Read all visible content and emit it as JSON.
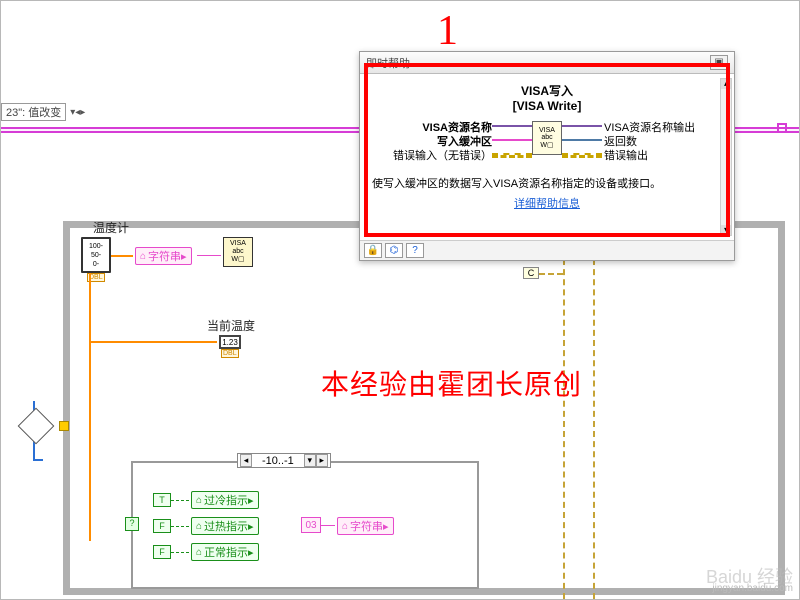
{
  "annotation": {
    "number": "1",
    "credit": "本经验由霍团长原创"
  },
  "topSelector": "23\": 值改变",
  "help": {
    "windowTitle": "即时帮助",
    "title1": "VISA写入",
    "title2": "[VISA Write]",
    "port_in_name": "VISA资源名称",
    "port_in_buf": "写入缓冲区",
    "port_in_err": "错误输入（无错误）",
    "port_out_name": "VISA资源名称输出",
    "port_out_ret": "返回数",
    "port_out_err": "错误输出",
    "desc": "使写入缓冲区的数据写入VISA资源名称指定的设备或接口。",
    "detailLink": "详细帮助信息",
    "iconTop": "VISA",
    "iconMid": "abc",
    "iconBot": "W▢"
  },
  "labels": {
    "thermometer": "温度计",
    "stringLink": "字符串",
    "currentTemp": "当前温度",
    "coldIndicator": "过冷指示",
    "hotIndicator": "过热指示",
    "normalIndicator": "正常指示"
  },
  "case": {
    "selector": "-10..-1",
    "num03": "03"
  },
  "visaNode": {
    "l1": "VISA",
    "l2": "abc",
    "l3": "W▢"
  },
  "watermark": {
    "brand": "Baidu 经验",
    "url": "jingyan.baidu.com"
  }
}
